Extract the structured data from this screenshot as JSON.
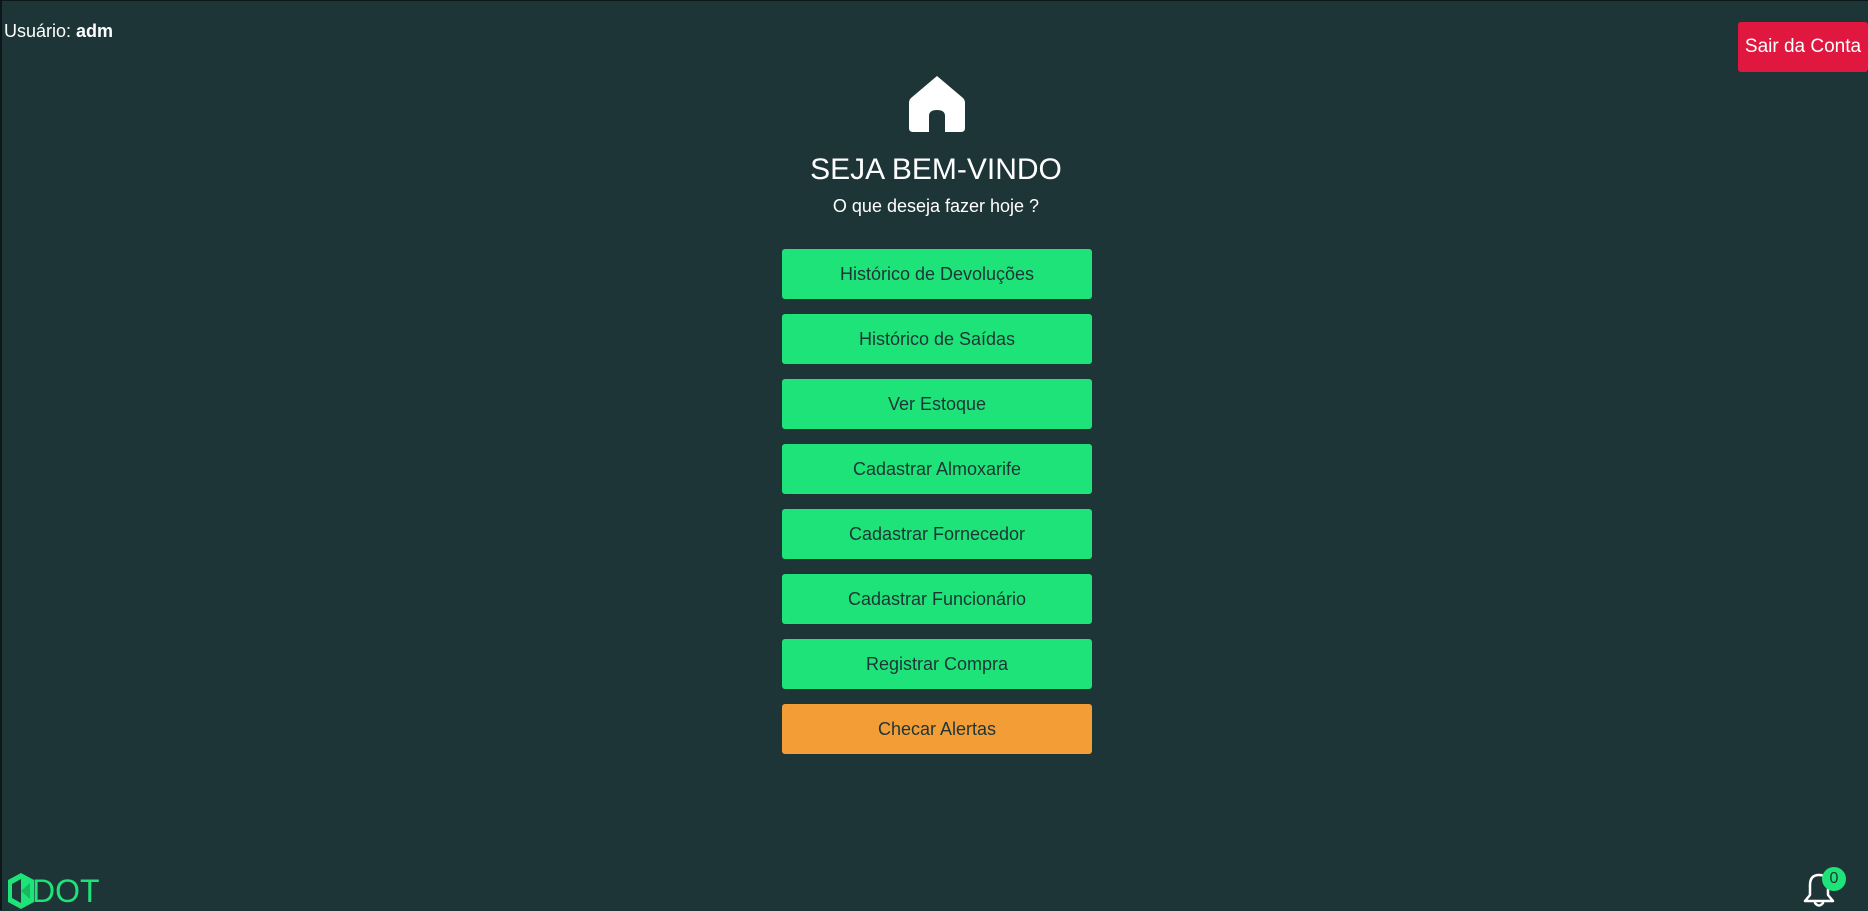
{
  "header": {
    "user_label": "Usuário:",
    "user_name": "adm",
    "logout_label": "Sair da Conta"
  },
  "main": {
    "icon": "home-icon",
    "title": "SEJA BEM-VINDO",
    "subtitle": "O que deseja fazer hoje ?",
    "menu": [
      {
        "label": "Histórico de Devoluções"
      },
      {
        "label": "Histórico de Saídas"
      },
      {
        "label": "Ver Estoque"
      },
      {
        "label": "Cadastrar Almoxarife"
      },
      {
        "label": "Cadastrar Fornecedor"
      },
      {
        "label": "Cadastrar Funcionário"
      },
      {
        "label": "Registrar Compra"
      },
      {
        "label": "Checar Alertas"
      }
    ]
  },
  "footer": {
    "logo_text": "DOT",
    "notification_icon": "bell-icon",
    "notification_count": "0"
  },
  "colors": {
    "background": "#1e3537",
    "primary_button": "#1ee378",
    "alert_button": "#f29d36",
    "logout_button": "#e0173f"
  }
}
